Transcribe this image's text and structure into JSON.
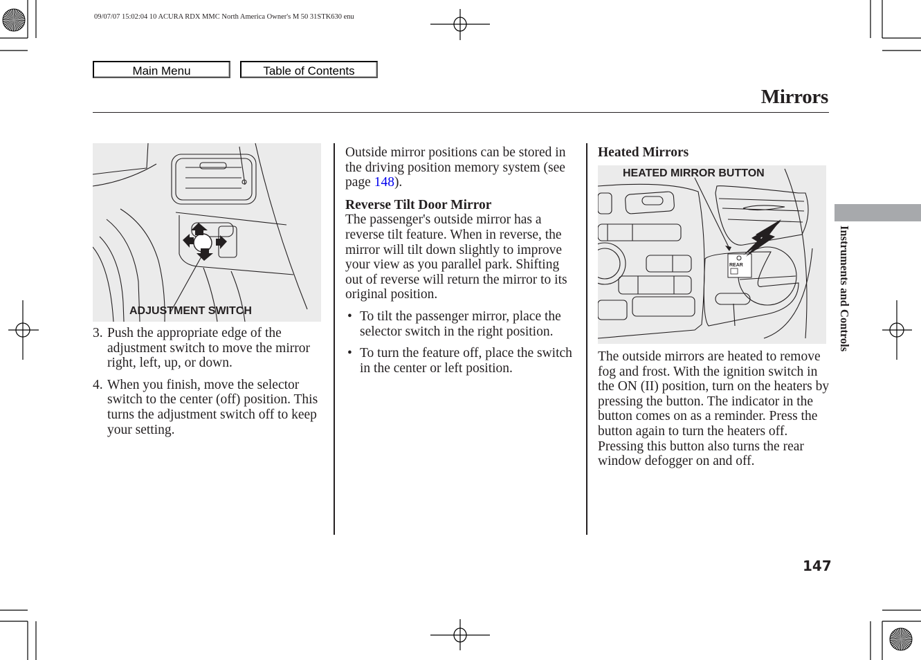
{
  "print_meta": "09/07/07 15:02:04    10 ACURA RDX MMC North America Owner's M 50 31STK630 enu",
  "nav": {
    "main_menu_label": "Main Menu",
    "toc_label": "Table of Contents"
  },
  "page": {
    "title": "Mirrors",
    "section_tab": "Instruments and Controls",
    "number": "147"
  },
  "left_column": {
    "figure_caption": "ADJUSTMENT SWITCH",
    "steps": [
      {
        "num": "3.",
        "text": "Push the appropriate edge of the adjustment switch to move the mirror right, left, up, or down."
      },
      {
        "num": "4.",
        "text": "When you finish, move the selector switch to the center (off) position. This turns the adjustment switch off to keep your setting."
      }
    ]
  },
  "middle_column": {
    "intro_before_link": "Outside mirror positions can be stored in the driving position memory system (see page ",
    "intro_link": "148",
    "intro_after_link": ").",
    "heading": "Reverse Tilt Door Mirror",
    "paragraph": "The passenger's outside mirror has a reverse tilt feature. When in reverse, the mirror will tilt down slightly to improve your view as you parallel park. Shifting out of reverse will return the mirror to its original position.",
    "bullets": [
      "To tilt the passenger mirror, place the selector switch in the right position.",
      "To turn the feature off, place the switch in the center or left position."
    ],
    "bullet_glyph": "•"
  },
  "right_column": {
    "heading": "Heated Mirrors",
    "figure_caption": "HEATED MIRROR BUTTON",
    "button_label": "REAR",
    "paragraph": "The outside mirrors are heated to remove fog and frost. With the ignition switch in the ON (II) position, turn on the heaters by pressing the button. The indicator in the button comes on as a reminder. Press the button again to turn the heaters off. Pressing this button also turns the rear window defogger on and off."
  },
  "colors": {
    "text": "#231f20",
    "link": "#0000ee",
    "figure_bg": "#ebebeb",
    "tab_gray": "#a7a9ac"
  }
}
